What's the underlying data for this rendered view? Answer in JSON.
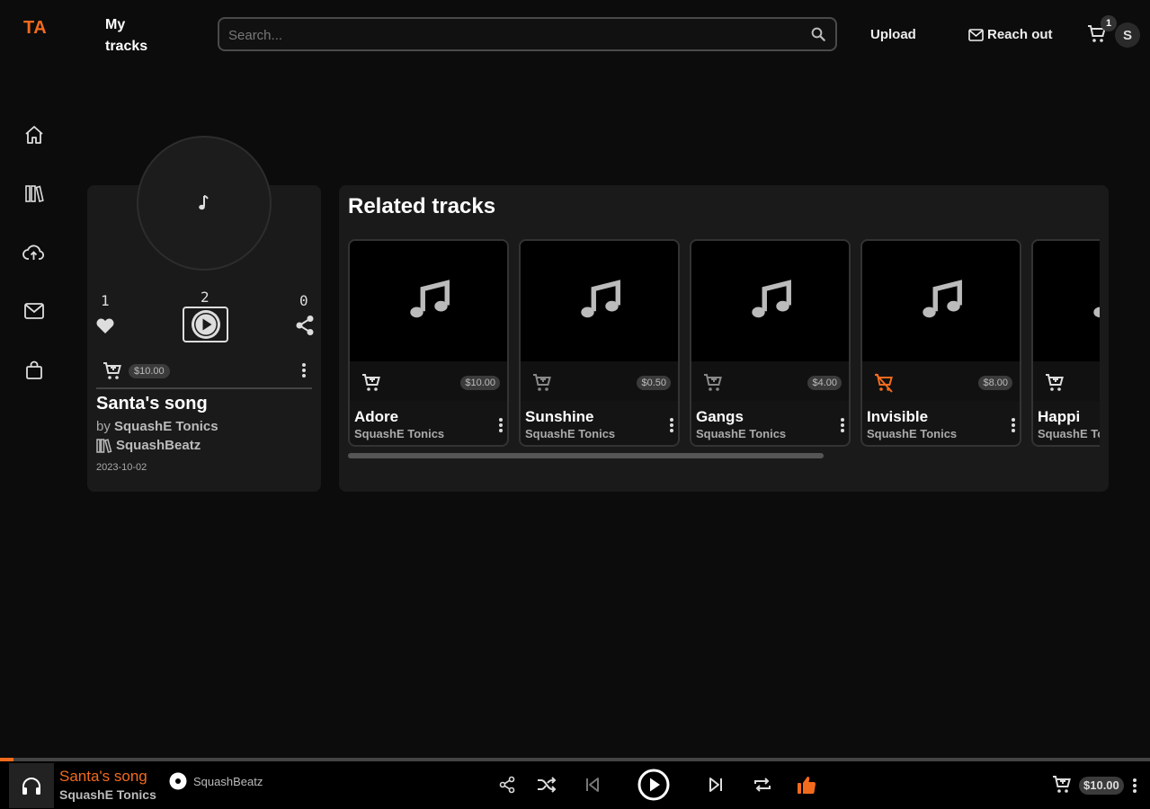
{
  "header": {
    "logo": "TA",
    "my_tracks": "My tracks",
    "search_placeholder": "Search...",
    "upload": "Upload",
    "reach_out": "Reach out",
    "cart_count": "1",
    "avatar_initial": "S"
  },
  "sidenav": {
    "items": [
      {
        "icon": "home-icon"
      },
      {
        "icon": "library-icon"
      },
      {
        "icon": "cloud-upload-icon"
      },
      {
        "icon": "mail-icon"
      },
      {
        "icon": "shopping-bag-icon"
      }
    ]
  },
  "track": {
    "likes": "1",
    "plays": "2",
    "shares": "0",
    "price": "$10.00",
    "title": "Santa's song",
    "by_prefix": "by",
    "artist": "SquashE Tonics",
    "label": "SquashBeatz",
    "date": "2023-10-02"
  },
  "related": {
    "heading": "Related tracks",
    "tracks": [
      {
        "name": "Adore",
        "artist": "SquashE Tonics",
        "price": "$10.00",
        "in_cart": false
      },
      {
        "name": "Sunshine",
        "artist": "SquashE Tonics",
        "price": "$0.50",
        "in_cart": false
      },
      {
        "name": "Gangs",
        "artist": "SquashE Tonics",
        "price": "$4.00",
        "in_cart": false
      },
      {
        "name": "Invisible",
        "artist": "SquashE Tonics",
        "price": "$8.00",
        "in_cart": true
      },
      {
        "name": "Happi",
        "artist": "SquashE Tonics",
        "price": "",
        "in_cart": false
      }
    ]
  },
  "player": {
    "progress": 0.012,
    "title": "Santa's song",
    "artist": "SquashE Tonics",
    "label": "SquashBeatz",
    "price": "$10.00"
  },
  "colors": {
    "accent": "#f26b1d",
    "background": "#0c0c0c",
    "card": "#1a1a1a"
  }
}
